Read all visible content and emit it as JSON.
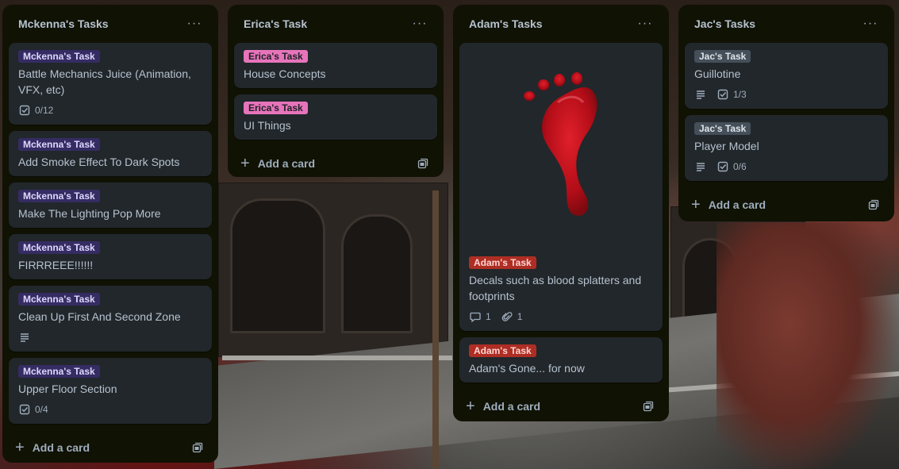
{
  "colors": {
    "list_bg": "#101204",
    "card_bg": "#22272b",
    "label_purple": "#352c63",
    "label_pink": "#e774bb",
    "label_red": "#ae2e24",
    "label_gray": "#454f59",
    "blood_red": "#c3101c"
  },
  "icons": {
    "menu": "ellipsis-icon",
    "checklist": "checklist-icon",
    "description": "description-icon",
    "comment": "comment-icon",
    "attachment": "paperclip-icon",
    "add": "plus-icon",
    "template": "template-icon"
  },
  "lists": [
    {
      "title": "Mckenna's Tasks",
      "menu_label": "···",
      "add_label": "Add a card",
      "cards": [
        {
          "label": "Mckenna's Task",
          "title": "Battle Mechanics Juice (Animation, VFX, etc)",
          "checklist": "0/12"
        },
        {
          "label": "Mckenna's Task",
          "title": "Add Smoke Effect To Dark Spots"
        },
        {
          "label": "Mckenna's Task",
          "title": "Make The Lighting Pop More"
        },
        {
          "label": "Mckenna's Task",
          "title": "FIRRREEE!!!!!!"
        },
        {
          "label": "Mckenna's Task",
          "title": "Clean Up First And Second Zone"
        },
        {
          "label": "Mckenna's Task",
          "title": "Upper Floor Section",
          "checklist": "0/4"
        }
      ]
    },
    {
      "title": "Erica's Task",
      "menu_label": "···",
      "add_label": "Add a card",
      "cards": [
        {
          "label": "Erica's Task",
          "title": "House Concepts"
        },
        {
          "label": "Erica's Task",
          "title": "UI Things"
        }
      ]
    },
    {
      "title": "Adam's Tasks",
      "menu_label": "···",
      "add_label": "Add a card",
      "cards": [
        {
          "label": "Adam's Task",
          "title": "Decals such as blood splatters and footprints",
          "comments": "1",
          "attachments": "1",
          "cover": "bloody-footprint-image"
        },
        {
          "label": "Adam's Task",
          "title": "Adam's Gone... for now"
        }
      ]
    },
    {
      "title": "Jac's Tasks",
      "menu_label": "···",
      "add_label": "Add a card",
      "cards": [
        {
          "label": "Jac's Task",
          "title": "Guillotine",
          "checklist": "1/3"
        },
        {
          "label": "Jac's Task",
          "title": "Player Model",
          "checklist": "0/6"
        }
      ]
    }
  ]
}
